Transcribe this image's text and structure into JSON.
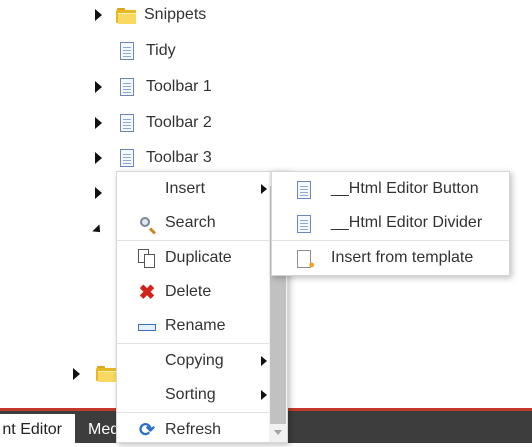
{
  "tree": {
    "items": [
      {
        "label": "Snippets",
        "icon": "folder-icon",
        "expandable": true
      },
      {
        "label": "Tidy",
        "icon": "document-icon",
        "expandable": false
      },
      {
        "label": "Toolbar 1",
        "icon": "document-icon",
        "expandable": true
      },
      {
        "label": "Toolbar 2",
        "icon": "document-icon",
        "expandable": true
      },
      {
        "label": "Toolbar 3",
        "icon": "document-icon",
        "expandable": true
      }
    ]
  },
  "context_menu": {
    "items": [
      {
        "label": "Insert",
        "icon": "",
        "has_submenu": true
      },
      {
        "label": "Search",
        "icon": "search-icon",
        "has_submenu": false
      },
      {
        "label": "Duplicate",
        "icon": "duplicate-icon",
        "has_submenu": false
      },
      {
        "label": "Delete",
        "icon": "delete-icon",
        "has_submenu": false
      },
      {
        "label": "Rename",
        "icon": "rename-icon",
        "has_submenu": false
      },
      {
        "label": "Copying",
        "icon": "",
        "has_submenu": true
      },
      {
        "label": "Sorting",
        "icon": "",
        "has_submenu": true
      },
      {
        "label": "Refresh",
        "icon": "refresh-icon",
        "has_submenu": false
      }
    ]
  },
  "insert_submenu": {
    "items": [
      {
        "label": "__Html Editor Button",
        "icon": "document-icon"
      },
      {
        "label": "__Html Editor Divider",
        "icon": "document-icon"
      },
      {
        "label": "Insert from template",
        "icon": "template-icon"
      }
    ]
  },
  "bottom_bar": {
    "tabs": [
      {
        "label": "nt Editor",
        "active": true
      },
      {
        "label": "Med",
        "active": false
      }
    ],
    "accent_color": "#c23a2c",
    "background_color": "#3d3d3d"
  }
}
